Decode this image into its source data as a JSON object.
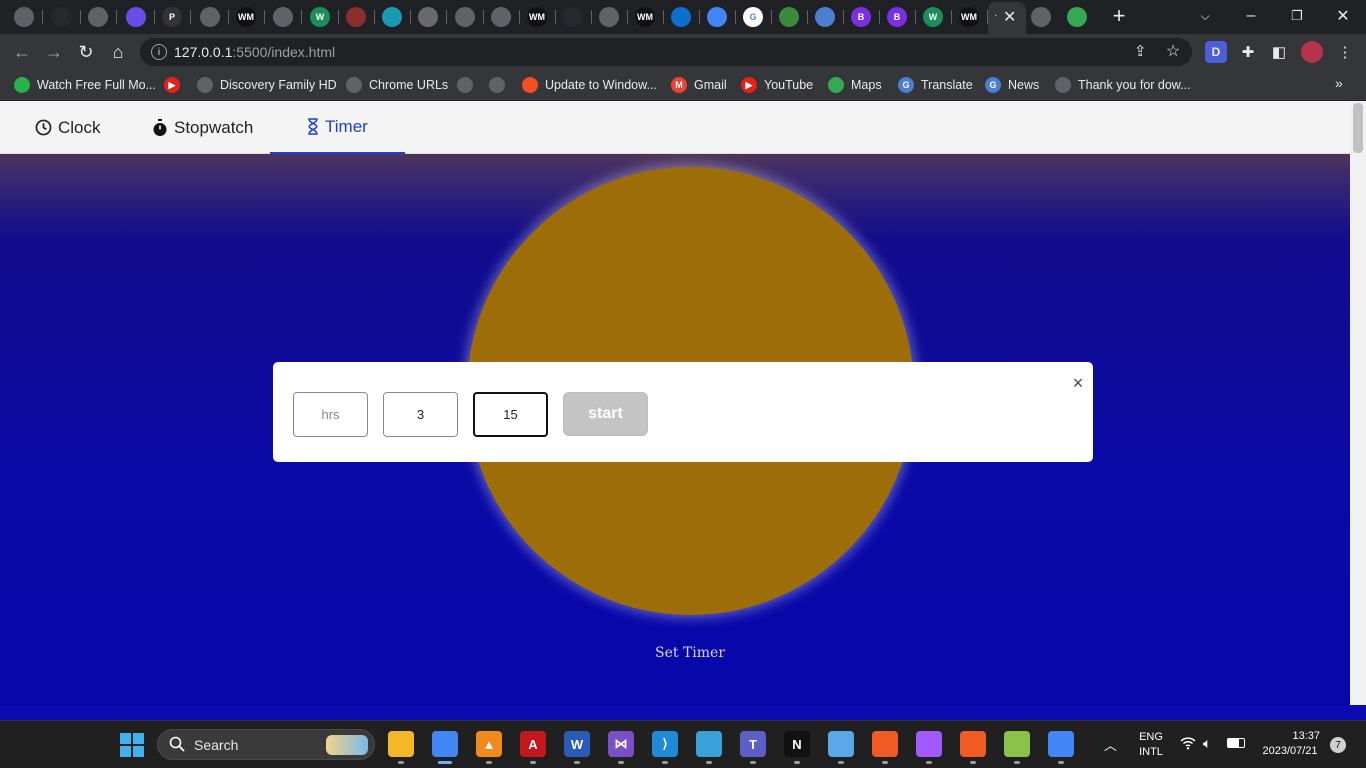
{
  "browser": {
    "url_host": "127.0.0.1",
    "url_path": ":5500/index.html",
    "profile_initial": "D",
    "tab_favicons": [
      {
        "icon": "globe-icon",
        "color": "#5f6368",
        "text": ""
      },
      {
        "icon": "github-icon",
        "color": "#24292e",
        "text": ""
      },
      {
        "icon": "globe-icon",
        "color": "#5f6368",
        "text": ""
      },
      {
        "icon": "circle-app-icon",
        "color": "#6b4ce6",
        "text": ""
      },
      {
        "icon": "p-icon",
        "color": "#333",
        "text": "P"
      },
      {
        "icon": "globe-icon",
        "color": "#5f6368",
        "text": ""
      },
      {
        "icon": "wm-icon",
        "color": "#111",
        "text": "WM"
      },
      {
        "icon": "globe-icon",
        "color": "#5f6368",
        "text": ""
      },
      {
        "icon": "w-icon",
        "color": "#1a8f5a",
        "text": "W"
      },
      {
        "icon": "app-icon",
        "color": "#8b2d2d",
        "text": ""
      },
      {
        "icon": "figma-dots-icon",
        "color": "#1a9bb3",
        "text": ""
      },
      {
        "icon": "plant-icon",
        "color": "#6a6a6a",
        "text": ""
      },
      {
        "icon": "globe-icon",
        "color": "#5f6368",
        "text": ""
      },
      {
        "icon": "globe-icon",
        "color": "#5f6368",
        "text": ""
      },
      {
        "icon": "wm-icon",
        "color": "#111",
        "text": "WM"
      },
      {
        "icon": "github-icon",
        "color": "#24292e",
        "text": ""
      },
      {
        "icon": "globe-icon",
        "color": "#5f6368",
        "text": ""
      },
      {
        "icon": "wm-icon",
        "color": "#111",
        "text": "WM"
      },
      {
        "icon": "onedrive-icon",
        "color": "#0a6fd1",
        "text": ""
      },
      {
        "icon": "chrome-icon",
        "color": "#4285f4",
        "text": ""
      },
      {
        "icon": "google-icon",
        "color": "#ffffff",
        "text": "G"
      },
      {
        "icon": "doc-icon",
        "color": "#3c8b3c",
        "text": ""
      },
      {
        "icon": "flag-icon",
        "color": "#4a7fd1",
        "text": ""
      },
      {
        "icon": "bootstrap-icon",
        "color": "#7b2fe0",
        "text": "B"
      },
      {
        "icon": "bootstrap-icon",
        "color": "#7b2fe0",
        "text": "B"
      },
      {
        "icon": "w-icon",
        "color": "#1a8f5a",
        "text": "W"
      },
      {
        "icon": "wm-icon",
        "color": "#111",
        "text": "WM"
      }
    ],
    "extra_tab_favicons": [
      {
        "icon": "globe-icon",
        "color": "#5f6368"
      },
      {
        "icon": "maps-icon",
        "color": "#34a853"
      }
    ],
    "bookmarks": [
      {
        "label": "Watch Free Full Mo...",
        "icon": "green-app-icon",
        "color": "#26b34a",
        "text": ""
      },
      {
        "label": "",
        "icon": "youtube-icon",
        "color": "#e62117",
        "text": "▶"
      },
      {
        "label": "Discovery Family HD",
        "icon": "globe-icon",
        "color": "#5f6368",
        "text": ""
      },
      {
        "label": "Chrome URLs",
        "icon": "globe-icon",
        "color": "#5f6368",
        "text": ""
      },
      {
        "label": "",
        "icon": "globe-icon",
        "color": "#5f6368",
        "text": ""
      },
      {
        "label": "",
        "icon": "globe-icon",
        "color": "#5f6368",
        "text": ""
      },
      {
        "label": "Update to Window...",
        "icon": "windows-logo-icon",
        "color": "#f25022",
        "text": ""
      },
      {
        "label": "Gmail",
        "icon": "gmail-icon",
        "color": "#ea4335",
        "text": "M"
      },
      {
        "label": "YouTube",
        "icon": "youtube-icon",
        "color": "#e62117",
        "text": "▶"
      },
      {
        "label": "Maps",
        "icon": "maps-icon",
        "color": "#34a853",
        "text": ""
      },
      {
        "label": "Translate",
        "icon": "translate-icon",
        "color": "#4a7fd1",
        "text": "G"
      },
      {
        "label": "News",
        "icon": "news-icon",
        "color": "#4a7fd1",
        "text": "G"
      },
      {
        "label": "Thank you for dow...",
        "icon": "globe-icon",
        "color": "#5f6368",
        "text": ""
      }
    ]
  },
  "app": {
    "tabs": [
      {
        "label": "Clock",
        "icon": "clock-icon",
        "active": false
      },
      {
        "label": "Stopwatch",
        "icon": "stopwatch-icon",
        "active": false
      },
      {
        "label": "Timer",
        "icon": "hourglass-icon",
        "active": true
      }
    ],
    "circle_color": "#9c6d08",
    "set_timer_label": "Set Timer",
    "modal": {
      "hours_placeholder": "hrs",
      "hours_value": "",
      "minutes_value": "3",
      "seconds_value": "15",
      "start_label": "start",
      "close_symbol": "×"
    }
  },
  "taskbar": {
    "search_label": "Search",
    "apps": [
      {
        "icon": "file-explorer-icon",
        "color": "#f2b827",
        "text": ""
      },
      {
        "icon": "chrome-icon",
        "color": "#4285f4",
        "text": ""
      },
      {
        "icon": "vlc-icon",
        "color": "#f08a1c",
        "text": "▲"
      },
      {
        "icon": "acrobat-icon",
        "color": "#c4161c",
        "text": "A"
      },
      {
        "icon": "word-icon",
        "color": "#2b5bb8",
        "text": "W"
      },
      {
        "icon": "visual-studio-icon",
        "color": "#7a4fc7",
        "text": "⋈"
      },
      {
        "icon": "vscode-icon",
        "color": "#1f8ad8",
        "text": "⟩"
      },
      {
        "icon": "snipping-icon",
        "color": "#3aa0d8",
        "text": ""
      },
      {
        "icon": "teams-icon",
        "color": "#5b5fc7",
        "text": "T"
      },
      {
        "icon": "netflix-icon",
        "color": "#111",
        "text": "N"
      },
      {
        "icon": "notepad-icon",
        "color": "#5aa9e6",
        "text": ""
      },
      {
        "icon": "brave-icon",
        "color": "#f05a24",
        "text": ""
      },
      {
        "icon": "figma-icon",
        "color": "#a259ff",
        "text": ""
      },
      {
        "icon": "brave-icon",
        "color": "#f05a24",
        "text": ""
      },
      {
        "icon": "notepad-plus-icon",
        "color": "#8bc34a",
        "text": ""
      },
      {
        "icon": "chrome-icon",
        "color": "#4285f4",
        "text": ""
      }
    ],
    "lang_line1": "ENG",
    "lang_line2": "INTL",
    "time": "13:37",
    "date": "2023/07/21",
    "notification_count": "7"
  }
}
